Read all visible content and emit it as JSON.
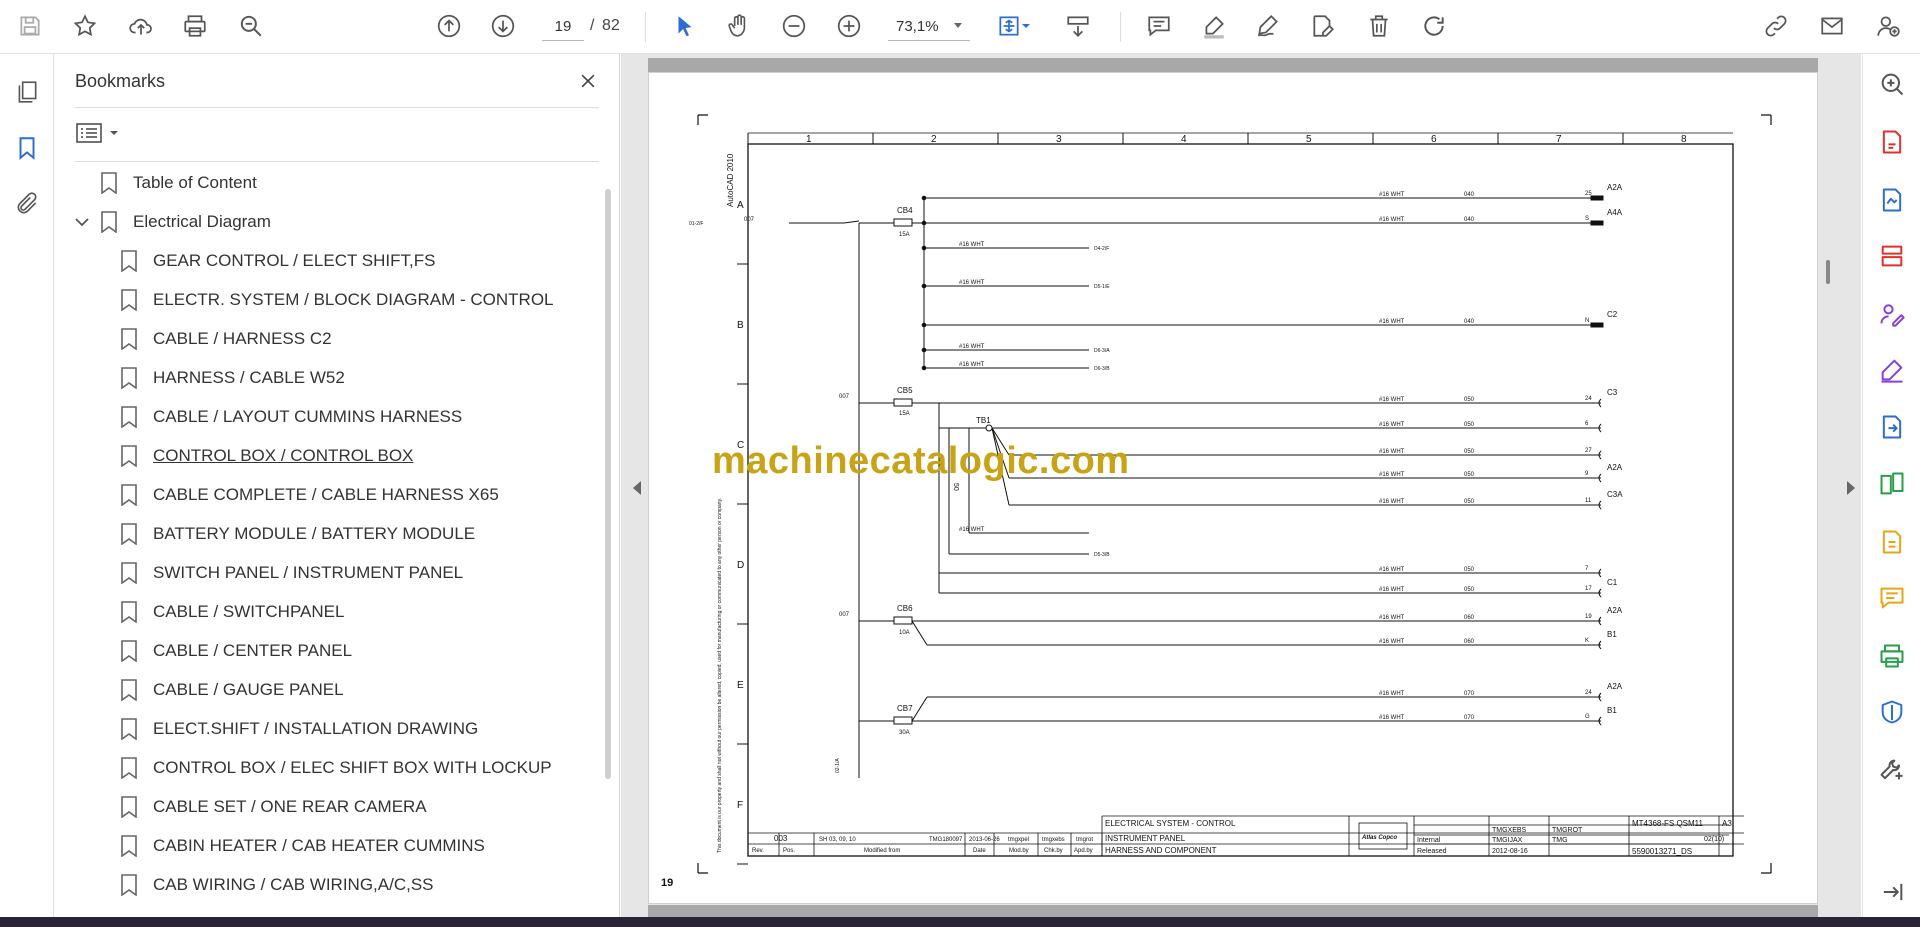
{
  "toolbar": {
    "page_current": "19",
    "page_separator": "/",
    "page_total": "82",
    "zoom": "73,1%",
    "icons": [
      "save-icon",
      "star-icon",
      "upload-icon",
      "print-icon",
      "zoom-search-icon",
      "page-up-icon",
      "page-down-icon",
      "select-arrow-icon",
      "hand-icon",
      "zoom-out-icon",
      "zoom-in-icon",
      "fit-page-icon",
      "scroll-mode-icon",
      "comment-icon",
      "highlight-icon",
      "sign-icon",
      "edit-icon",
      "delete-icon",
      "rotate-icon",
      "share-link-icon",
      "mail-icon",
      "account-icon"
    ]
  },
  "left_rail": {
    "icons": [
      "pages-icon",
      "bookmark-icon",
      "attachment-icon"
    ]
  },
  "bookmarks": {
    "title": "Bookmarks",
    "items": [
      {
        "label": "Table of Content",
        "level": 0
      },
      {
        "label": "Electrical Diagram",
        "level": 0,
        "expanded": true
      },
      {
        "label": "GEAR CONTROL / ELECT SHIFT,FS",
        "level": 1
      },
      {
        "label": "ELECTR. SYSTEM / BLOCK DIAGRAM - CONTROL",
        "level": 1
      },
      {
        "label": "CABLE / HARNESS C2",
        "level": 1
      },
      {
        "label": "HARNESS / CABLE W52",
        "level": 1
      },
      {
        "label": "CABLE / LAYOUT CUMMINS HARNESS",
        "level": 1
      },
      {
        "label": "CONTROL BOX / CONTROL BOX",
        "level": 1,
        "active": true
      },
      {
        "label": "CABLE COMPLETE / CABLE HARNESS X65",
        "level": 1
      },
      {
        "label": "BATTERY MODULE / BATTERY MODULE",
        "level": 1
      },
      {
        "label": "SWITCH PANEL / INSTRUMENT PANEL",
        "level": 1
      },
      {
        "label": "CABLE / SWITCHPANEL",
        "level": 1
      },
      {
        "label": "CABLE / CENTER PANEL",
        "level": 1
      },
      {
        "label": "CABLE / GAUGE PANEL",
        "level": 1
      },
      {
        "label": "ELECT.SHIFT / INSTALLATION DRAWING",
        "level": 1
      },
      {
        "label": "CONTROL BOX / ELEC SHIFT BOX WITH LOCKUP",
        "level": 1
      },
      {
        "label": "CABLE SET / ONE REAR CAMERA",
        "level": 1
      },
      {
        "label": "CABIN HEATER / CAB HEATER CUMMINS",
        "level": 1
      },
      {
        "label": "CAB WIRING / CAB WIRING,A/C,SS",
        "level": 1
      }
    ]
  },
  "drawing": {
    "page_number": "19",
    "software": "AutoCAD 2010",
    "columns": [
      "1",
      "2",
      "3",
      "4",
      "5",
      "6",
      "7",
      "8"
    ],
    "rows": [
      "A",
      "B",
      "C",
      "D",
      "E",
      "F"
    ],
    "breakers": [
      {
        "name": "CB4",
        "rating": "15A"
      },
      {
        "name": "CB5",
        "rating": "15A"
      },
      {
        "name": "CB6",
        "rating": "10A"
      },
      {
        "name": "CB7",
        "rating": "30A"
      }
    ],
    "terminal_block": "TB1",
    "wire_label": "#16 WHT",
    "wire_numbers": [
      "007",
      "040",
      "050",
      "060",
      "070",
      "50"
    ],
    "connectors": [
      {
        "pin": "25",
        "name": "A2A"
      },
      {
        "pin": "S",
        "name": "A4A"
      },
      {
        "pin": "N",
        "name": "C2"
      },
      {
        "pin": "24",
        "name": "C3"
      },
      {
        "pin": "6",
        "name": ""
      },
      {
        "pin": "27",
        "name": ""
      },
      {
        "pin": "9",
        "name": "A2A"
      },
      {
        "pin": "11",
        "name": "C3A"
      },
      {
        "pin": "7",
        "name": ""
      },
      {
        "pin": "17",
        "name": "C1"
      },
      {
        "pin": "19",
        "name": "A2A"
      },
      {
        "pin": "K",
        "name": "B1"
      },
      {
        "pin": "24",
        "name": "A2A"
      },
      {
        "pin": "G",
        "name": "B1"
      }
    ],
    "refs": [
      "01-2/F",
      "D4-2/F",
      "D5-1/E",
      "D6-3/A",
      "D6-3/B",
      "D5-3/B",
      "02-1/A"
    ],
    "title_block": {
      "title1": "ELECTRICAL SYSTEM - CONTROL",
      "title2": "INSTRUMENT PANEL",
      "title3": "HARNESS AND COMPONENT",
      "rev": "003",
      "sheet_ref": "SH 03, 09, 10",
      "change": "TMG180097",
      "date_mod": "2013-06-26",
      "modby": "tmgxpel",
      "chkby": "tmgxebs",
      "apdby": "tmgrot",
      "col_rev": "Rev.",
      "col_pos": "Pos.",
      "col_modified": "Modified from",
      "col_date": "Date",
      "col_modby": "Mod.by",
      "col_chkby": "Chk.by",
      "col_apdby": "Apd.by",
      "logo": "Atlas Copco",
      "confidentiality": "Internal",
      "drawn": "TMGXEBS",
      "drawn2": "TMGIJAX",
      "approved": "TMGROT",
      "approved2": "TMG",
      "status": "Released",
      "date": "2012-08-16",
      "designation": "MT4368-FS QSM11",
      "size": "A3",
      "sheet": "02(10)",
      "doc_number": "5590013271_DS",
      "disclaimer": "This document is our property and shall not without our permission be altered, copied, used for manufacturing or communicated to any other person or company."
    }
  },
  "watermark": "machinecatalogic.com",
  "right_rail": {
    "icons": [
      "zoom-tool-icon",
      "export-pdf-icon",
      "create-pdf-icon",
      "organize-pages-icon",
      "request-signature-icon",
      "fill-sign-icon",
      "export-convert-icon",
      "compare-icon",
      "edit-pdf-icon",
      "comment-tool-icon",
      "print-production-icon",
      "protect-icon",
      "more-tools-icon",
      "collapse-panel-icon"
    ],
    "colors": {
      "red": "#e0312b",
      "blue": "#2d6dd2",
      "purple": "#8b3fd9",
      "green": "#2a9d48",
      "yellow": "#e7a51a",
      "magenta": "#c52ba1",
      "gray": "#555555"
    }
  }
}
